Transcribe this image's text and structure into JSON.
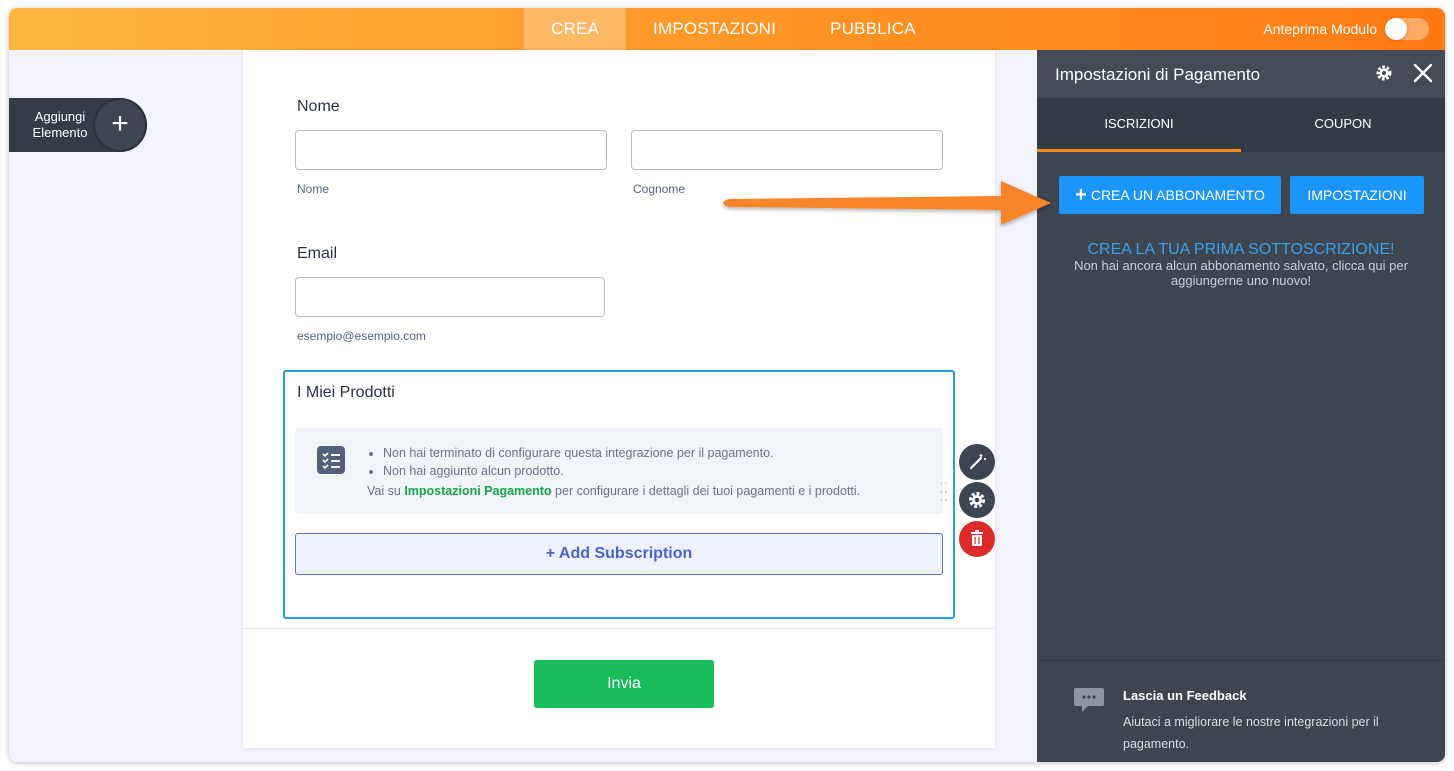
{
  "topbar": {
    "tabs": [
      {
        "label": "CREA",
        "active": true
      },
      {
        "label": "IMPOSTAZIONI",
        "active": false
      },
      {
        "label": "PUBBLICA",
        "active": false
      }
    ],
    "preview_label": "Anteprima Modulo",
    "preview_on": false
  },
  "add_element": {
    "label": "Aggiungi Elemento",
    "icon": "plus-icon"
  },
  "form": {
    "name_label": "Nome",
    "first_name_sublabel": "Nome",
    "last_name_sublabel": "Cognome",
    "email_label": "Email",
    "email_sublabel": "esempio@esempio.com",
    "products": {
      "title": "I Miei Prodotti",
      "notice_items": [
        "Non hai terminato di configurare questa integrazione per il pagamento.",
        "Non hai aggiunto alcun prodotto."
      ],
      "notice_prefix": "Vai su",
      "notice_link": "Impostazioni Pagamento",
      "notice_suffix": "per configurare i dettagli dei tuoi pagamenti e i prodotti.",
      "add_subscription": "+ Add Subscription"
    },
    "tools": [
      "wand-icon",
      "gear-icon",
      "trash-icon"
    ],
    "submit_label": "Invia"
  },
  "panel": {
    "title": "Impostazioni di Pagamento",
    "tabs": [
      {
        "label": "ISCRIZIONI",
        "active": true
      },
      {
        "label": "COUPON",
        "active": false
      }
    ],
    "create_button": "CREA UN ABBONAMENTO",
    "settings_button": "IMPOSTAZIONI",
    "empty_title": "CREA LA TUA PRIMA SOTTOSCRIZIONE!",
    "empty_subtitle": "Non hai ancora alcun abbonamento salvato, clicca qui per aggiungerne uno nuovo!",
    "feedback_title": "Lascia un Feedback",
    "feedback_text": "Aiutaci a migliorare le nostre integrazioni per il pagamento."
  },
  "colors": {
    "accent_orange": "#ff8a1e",
    "button_blue": "#1b95f7",
    "submit_green": "#18bd5b",
    "panel_bg": "#3e454f"
  }
}
